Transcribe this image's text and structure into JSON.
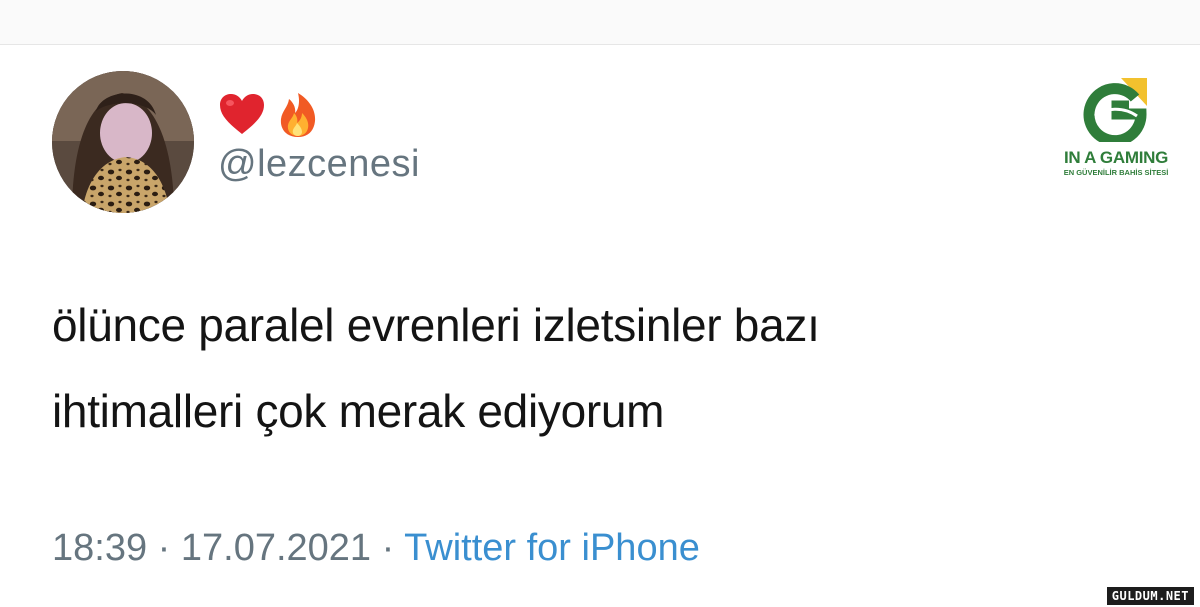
{
  "tweet": {
    "display_name_emojis": [
      "heart-emoji",
      "fire-emoji"
    ],
    "handle": "@lezcenesi",
    "text_lines": [
      "ölünce paralel evrenleri izletsinler bazı",
      "ihtimalleri çok merak ediyorum"
    ],
    "time": "18:39",
    "separator": "·",
    "date": "17.07.2021",
    "source": "Twitter for iPhone"
  },
  "brand": {
    "name": "IN A GAMING",
    "tagline": "EN GÜVENİLİR BAHİS SİTESİ"
  },
  "watermark": "GULDUM.NET",
  "colors": {
    "handle": "#66757f",
    "source_link": "#3a8fd0",
    "brand_green": "#2f7d3a",
    "brand_yellow": "#f2c12e"
  }
}
